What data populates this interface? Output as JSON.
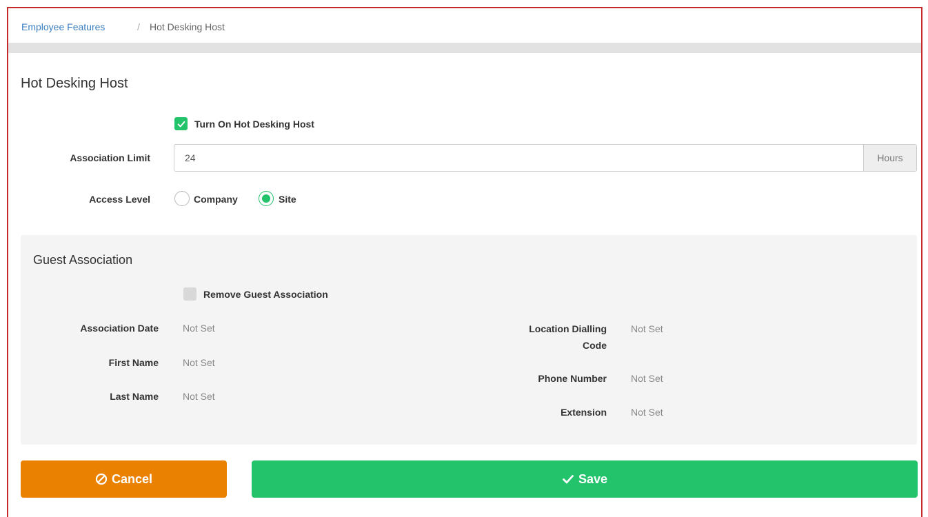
{
  "breadcrumb": {
    "parent": "Employee Features",
    "separator": "/",
    "current": "Hot Desking Host"
  },
  "page_title": "Hot Desking Host",
  "turn_on": {
    "label": "Turn On Hot Desking Host",
    "checked": true
  },
  "association_limit": {
    "label": "Association Limit",
    "value": "24",
    "addon": "Hours"
  },
  "access_level": {
    "label": "Access Level",
    "options": [
      {
        "label": "Company",
        "selected": false
      },
      {
        "label": "Site",
        "selected": true
      }
    ]
  },
  "guest_association": {
    "title": "Guest Association",
    "remove": {
      "label": "Remove Guest Association",
      "checked": false
    },
    "left_fields": [
      {
        "label": "Association Date",
        "value": "Not Set"
      },
      {
        "label": "First Name",
        "value": "Not Set"
      },
      {
        "label": "Last Name",
        "value": "Not Set"
      }
    ],
    "right_fields": [
      {
        "label_line1": "Location Dialling",
        "label_line2": "Code",
        "value": "Not Set"
      },
      {
        "label": "Phone Number",
        "value": "Not Set"
      },
      {
        "label": "Extension",
        "value": "Not Set"
      }
    ]
  },
  "buttons": {
    "cancel": "Cancel",
    "save": "Save"
  },
  "colors": {
    "accent_green": "#22c36b",
    "cancel_orange": "#ea8100",
    "border_red": "#c6282b",
    "link_blue": "#3c7fc1"
  },
  "icons": {
    "checkbox_check": "check-icon",
    "cancel": "ban-icon",
    "save": "check-icon"
  }
}
